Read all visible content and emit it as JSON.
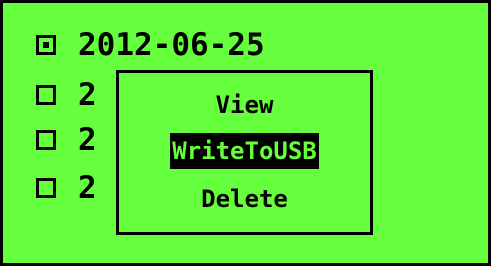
{
  "list": {
    "rows": [
      {
        "text": "2012-06-25",
        "checked": true
      },
      {
        "text": "2",
        "checked": false
      },
      {
        "text": "2",
        "checked": false
      },
      {
        "text": "2",
        "checked": false
      }
    ]
  },
  "menu": {
    "items": [
      "View",
      "WriteToUSB",
      "Delete"
    ],
    "selected_index": 1
  },
  "colors": {
    "screen_background": "#66ff3d",
    "foreground": "#000000"
  }
}
